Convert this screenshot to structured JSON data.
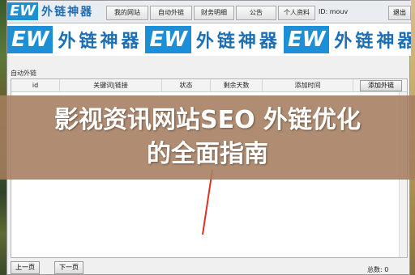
{
  "header": {
    "logo": {
      "mark": "EW",
      "text": "外链神器"
    },
    "nav": [
      "我的网站",
      "自动外链",
      "财务明细",
      "公告",
      "个人资料"
    ],
    "id_label": "ID: mouv",
    "exit_label": "退出"
  },
  "banner": {
    "logos": [
      {
        "mark": "EW",
        "text": "外链神器"
      },
      {
        "mark": "EW",
        "text": "外链神器"
      },
      {
        "mark": "EW",
        "text": "外链神器"
      }
    ]
  },
  "section": {
    "title": "自动外链"
  },
  "table": {
    "columns": [
      "id",
      "关键词|链接",
      "状态",
      "剩余天数",
      "添加时间"
    ],
    "add_button": "添加外链"
  },
  "overlay": {
    "title_line1": "影视资讯网站SEO 外链优化",
    "title_line2": "的全面指南"
  },
  "footer": {
    "prev": "上一页",
    "next": "下一页",
    "total": "总数: 0"
  },
  "colors": {
    "brand": "#1d8fd6",
    "overlay": "#a57d5f",
    "arrow": "#e03020"
  }
}
